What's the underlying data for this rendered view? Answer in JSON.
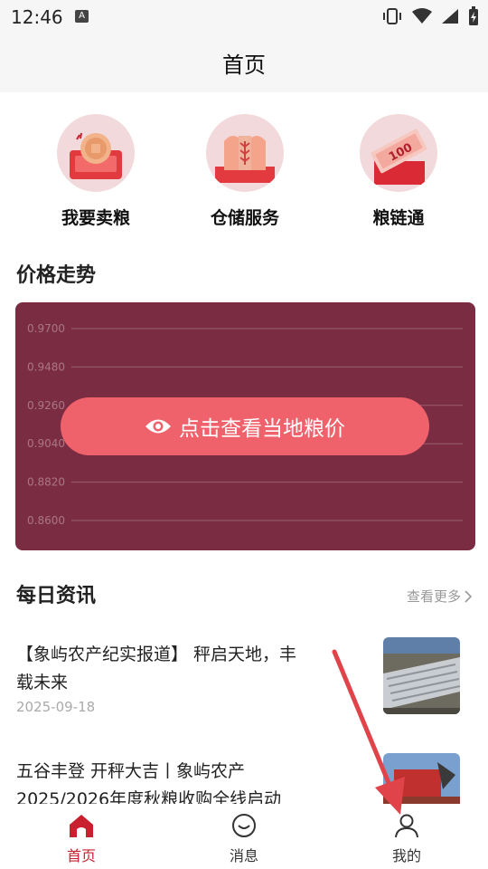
{
  "status": {
    "time": "12:46",
    "a_badge": "A"
  },
  "header": {
    "title": "首页"
  },
  "quick_actions": [
    {
      "label": "我要卖粮",
      "icon": "coin-cart-icon"
    },
    {
      "label": "仓储服务",
      "icon": "granary-icon"
    },
    {
      "label": "粮链通",
      "icon": "money-envelope-icon"
    }
  ],
  "price_trend": {
    "section_title": "价格走势",
    "button_label": "点击查看当地粮价"
  },
  "chart_data": {
    "type": "line",
    "y_ticks": [
      "0.9700",
      "0.9480",
      "0.9260",
      "0.9040",
      "0.8820",
      "0.8600"
    ],
    "ylim": [
      0.86,
      0.97
    ],
    "grid": true,
    "series": []
  },
  "news": {
    "section_title": "每日资讯",
    "more_label": "查看更多",
    "items": [
      {
        "title": "【象屿农产纪实报道】 秤启天地，丰载未来",
        "date": "2025-09-18"
      },
      {
        "title": "五谷丰登 开秤大吉丨象屿农产2025/2026年度秋粮收购全线启动",
        "date": ""
      }
    ]
  },
  "tabs": [
    {
      "label": "首页",
      "active": true
    },
    {
      "label": "消息",
      "active": false
    },
    {
      "label": "我的",
      "active": false
    }
  ],
  "colors": {
    "accent": "#c8202f",
    "chart_bg": "#7a2c42",
    "button": "#f0626b",
    "annotation_arrow": "#e0444a"
  }
}
